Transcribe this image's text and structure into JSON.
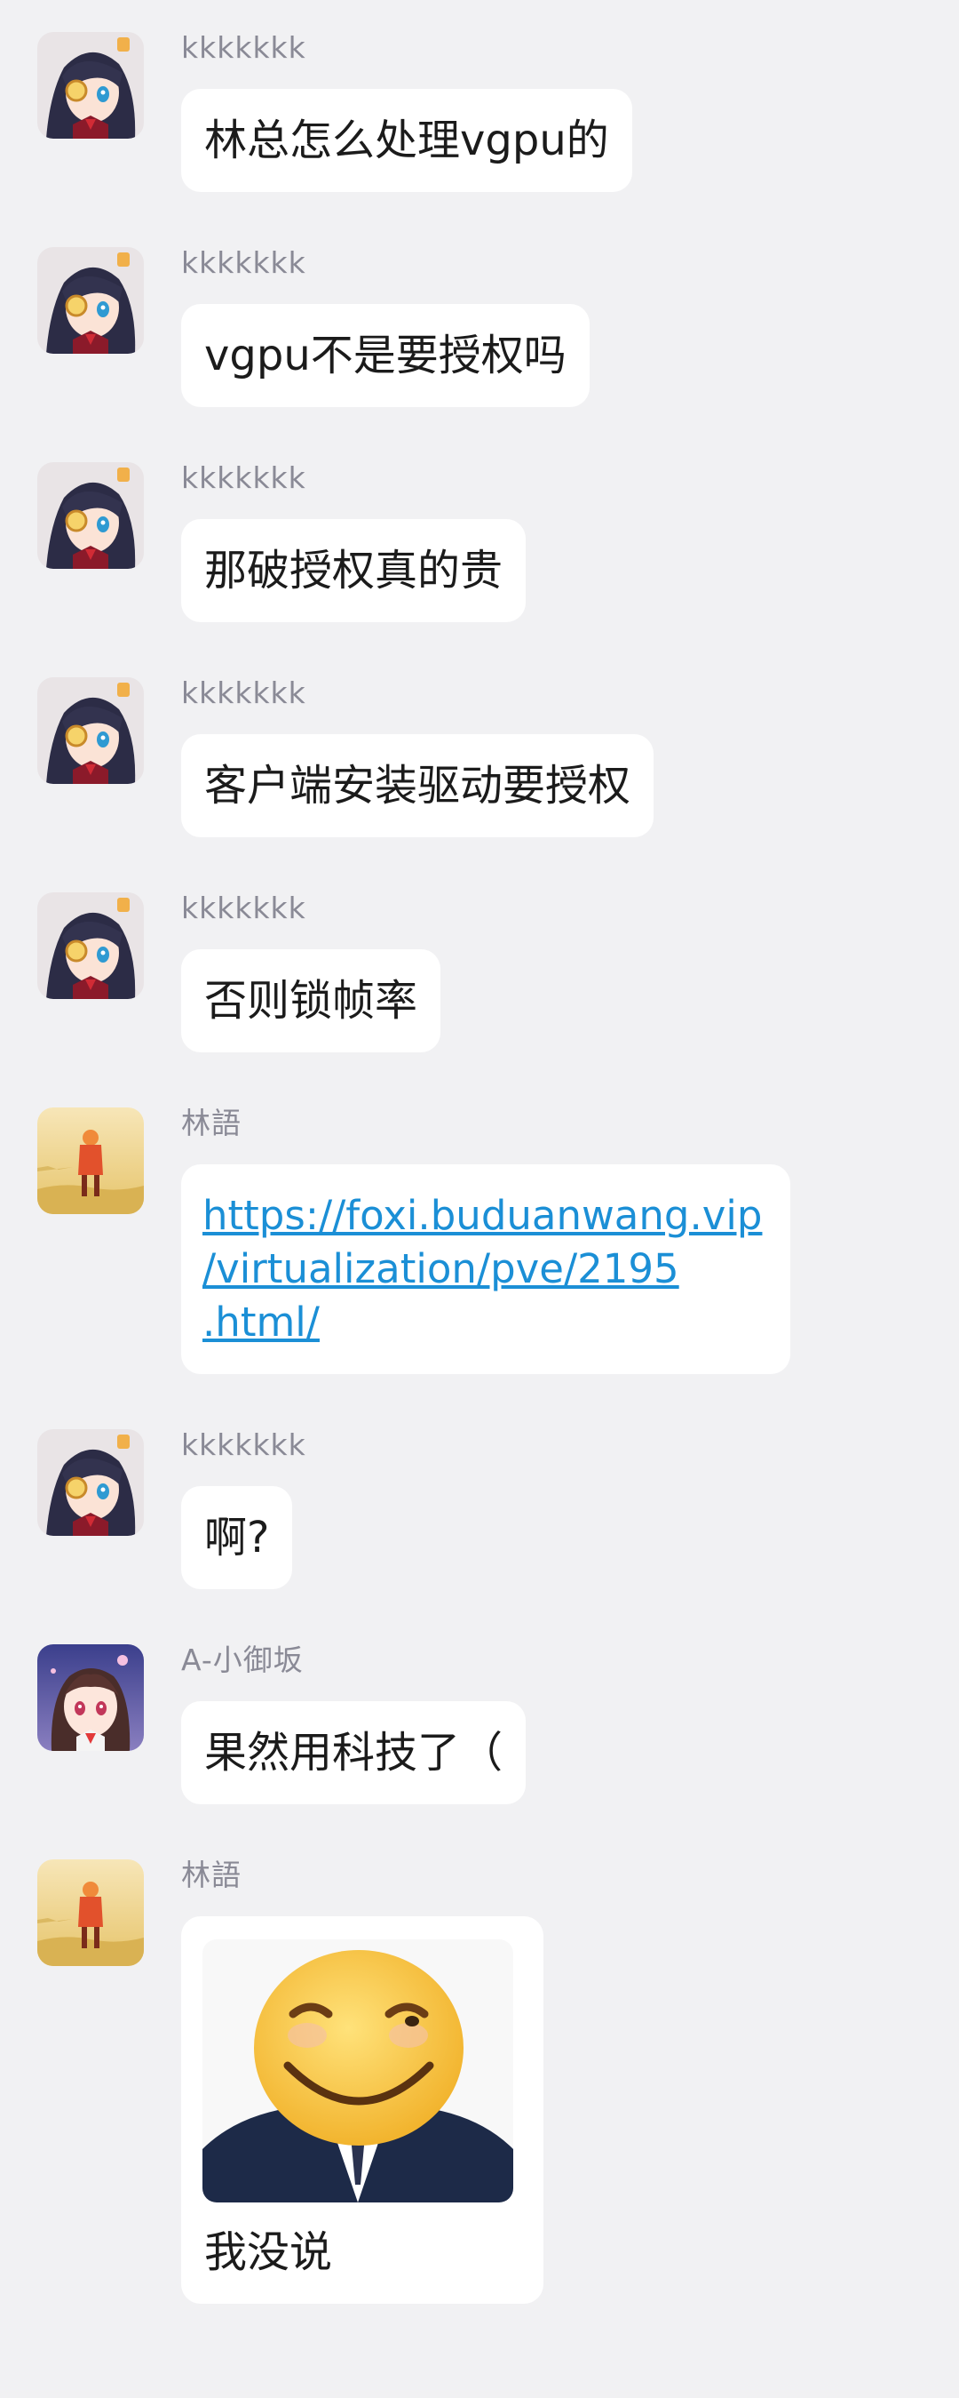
{
  "messages": [
    {
      "sender": "kkkkkkk",
      "text": "林总怎么处理vgpu的"
    },
    {
      "sender": "kkkkkkk",
      "text": "vgpu不是要授权吗"
    },
    {
      "sender": "kkkkkkk",
      "text": "那破授权真的贵"
    },
    {
      "sender": "kkkkkkk",
      "text": "客户端安装驱动要授权"
    },
    {
      "sender": "kkkkkkk",
      "text": "否则锁帧率"
    },
    {
      "sender": "林語",
      "link": "https://foxi.buduanwang.vip\n/virtualization/pve/2195\n.html/"
    },
    {
      "sender": "kkkkkkk",
      "text": "啊?"
    },
    {
      "sender": "A-小御坂",
      "text": "果然用科技了（"
    },
    {
      "sender": "林語",
      "sticker": "smiling-face-in-suit-sticker",
      "text": "我没说"
    }
  ],
  "colors": {
    "background": "#f1f1f3",
    "bubble": "#ffffff",
    "sender": "#8a8a96",
    "text": "#1b1b1b",
    "link": "#1b8fd6"
  },
  "icons": {
    "kkkkkkk": "anime-girl-eyepatch-avatar",
    "林語": "red-figure-yellow-field-avatar",
    "A-小御坂": "anime-girl-pink-hair-avatar"
  }
}
